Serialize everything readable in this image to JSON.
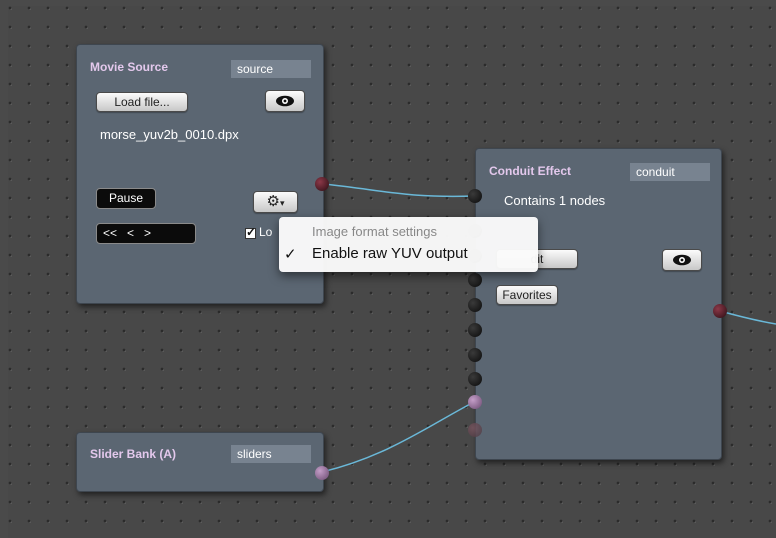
{
  "movie_source": {
    "title": "Movie Source",
    "name": "source",
    "load_file_label": "Load file...",
    "filename": "morse_yuv2b_0010.dpx",
    "pause_label": "Pause",
    "transport_label": "<<   <   >",
    "loop_label": "Lo",
    "settings_icon": "gear-icon",
    "view_icon": "eye-icon"
  },
  "conduit_effect": {
    "title": "Conduit Effect",
    "name": "conduit",
    "info": "Contains 1 nodes",
    "edit_label": "dit",
    "favorites_label": "Favorites",
    "view_icon": "eye-icon"
  },
  "slider_bank": {
    "title": "Slider Bank (A)",
    "name": "sliders"
  },
  "popup_menu": {
    "header": "Image format settings",
    "items": [
      {
        "label": "Enable raw YUV output",
        "checked": true,
        "check_mark": "✓"
      }
    ]
  },
  "colors": {
    "node_bg": "#5b6672",
    "title_text": "#e3c8ec",
    "wire": "#6ab8d8"
  }
}
